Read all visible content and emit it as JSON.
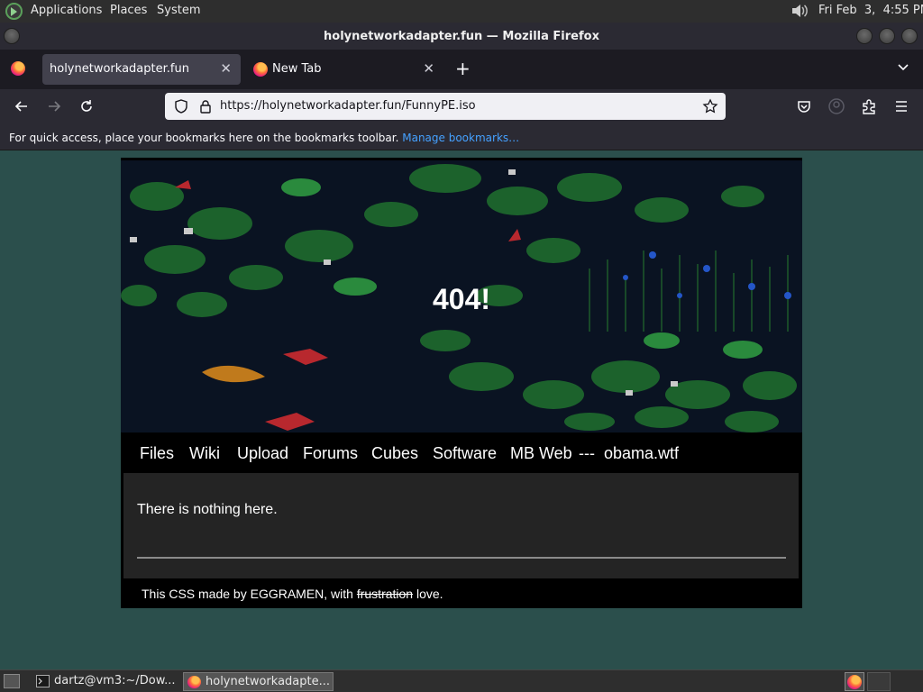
{
  "top_panel": {
    "menus": [
      "Applications",
      "Places",
      "System"
    ],
    "clock": "Fri Feb  3,  4:55 PM"
  },
  "window": {
    "title": "holynetworkadapter.fun — Mozilla Firefox"
  },
  "tabs": [
    {
      "label": "holynetworkadapter.fun",
      "active": true
    },
    {
      "label": "New Tab",
      "active": false
    }
  ],
  "urlbar": {
    "url": "https://holynetworkadapter.fun/FunnyPE.iso"
  },
  "bookmarks_bar": {
    "hint": "For quick access, place your bookmarks here on the bookmarks toolbar.",
    "manage_link": "Manage bookmarks…"
  },
  "page": {
    "heading": "404!",
    "nav": [
      "Files",
      "Wiki",
      "Upload",
      "Forums",
      "Cubes",
      "Software",
      "MB Web",
      "---",
      "obama.wtf"
    ],
    "message": "There is nothing here.",
    "footer": {
      "prefix": "This CSS made by EGGRAMEN, with",
      "struck": "frustration",
      "suffix": "love."
    }
  },
  "taskbar": {
    "tasks": [
      {
        "label": "dartz@vm3:~/Dow..."
      },
      {
        "label": "holynetworkadapte..."
      }
    ]
  },
  "colors": {
    "desktop": "#2b4f4c",
    "toolbar": "#2b2a33",
    "tabstrip": "#1c1b22",
    "link": "#45a1ff"
  }
}
